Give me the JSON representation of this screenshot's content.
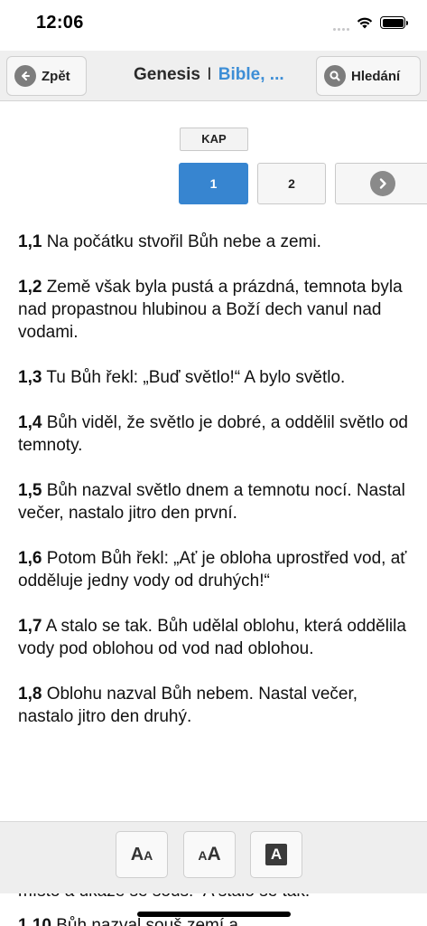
{
  "status_bar": {
    "time": "12:06"
  },
  "nav": {
    "back_label": "Zpět",
    "title_book": "Genesis",
    "title_separator": "I",
    "title_translation": "Bible, ...",
    "search_label": "Hledání"
  },
  "chapter_selector": {
    "label": "KAP",
    "chapters": [
      "1",
      "2"
    ],
    "active_chapter": "1"
  },
  "verses": [
    {
      "num": "1,1",
      "text": "Na počátku stvořil Bůh nebe a zemi."
    },
    {
      "num": "1,2",
      "text": "Země však byla pustá a prázdná, temnota byla nad propastnou hlubinou a Boží dech vanul nad vodami."
    },
    {
      "num": "1,3",
      "text": "Tu Bůh řekl: „Buď světlo!“ A bylo světlo."
    },
    {
      "num": "1,4",
      "text": "Bůh viděl, že světlo je dobré, a oddělil světlo od temnoty."
    },
    {
      "num": "1,5",
      "text": "Bůh nazval světlo dnem a temnotu nocí. Nastal večer, nastalo jitro den první."
    },
    {
      "num": "1,6",
      "text": "Potom Bůh řekl: „Ať je obloha uprostřed vod, ať odděluje jedny vody od druhých!“"
    },
    {
      "num": "1,7",
      "text": "A stalo se tak. Bůh udělal oblohu, která oddělila vody pod oblohou od vod nad oblohou."
    },
    {
      "num": "1,8",
      "text": "Oblohu nazval Bůh nebem. Nastal večer, nastalo jitro den druhý."
    }
  ],
  "underflow": {
    "partial_line": "místo a ukáže se souš!“ A stalo se tak.",
    "next_verse_partial": "1,10 Bůh nazval souš zemí a"
  },
  "toolbar": {
    "buttons": [
      {
        "icon": "decrease-font-icon",
        "label": "AA"
      },
      {
        "icon": "increase-font-icon",
        "label": "AA"
      },
      {
        "icon": "dark-mode-icon",
        "label": "A"
      }
    ]
  },
  "colors": {
    "accent": "#3785d0",
    "title_blue": "#3d8ed6",
    "toolbar_bg": "#eeeeee"
  }
}
